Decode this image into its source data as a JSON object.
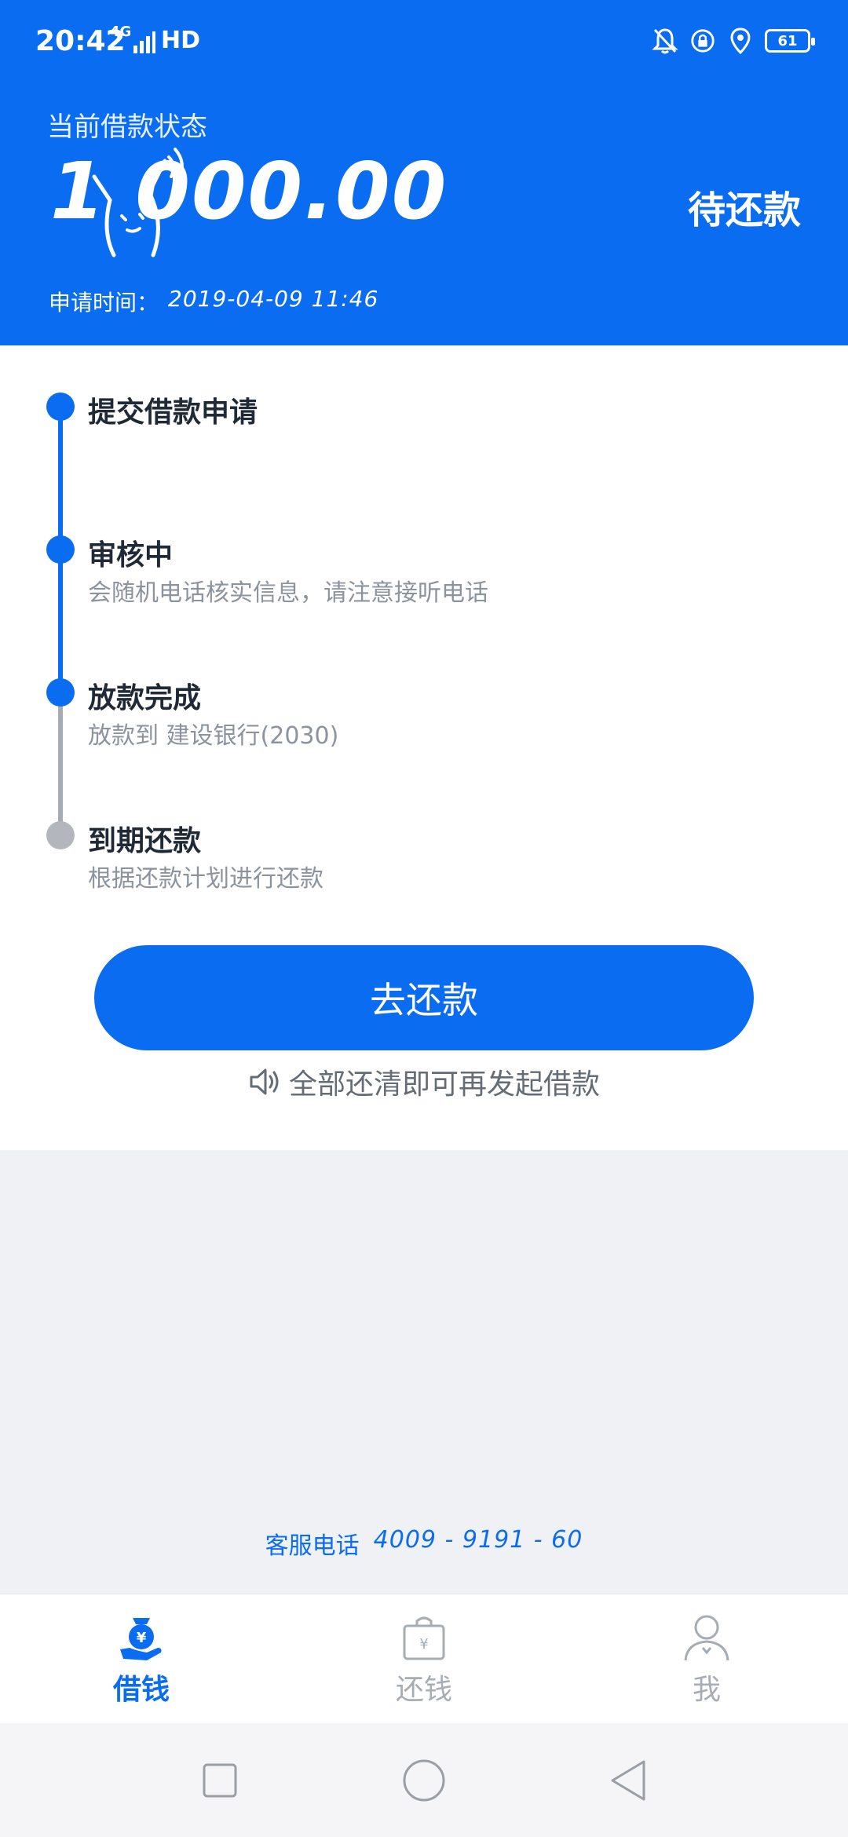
{
  "statusbar": {
    "time": "20:42",
    "network": "4G",
    "hd": "HD",
    "battery": "61"
  },
  "header": {
    "status_label": "当前借款状态",
    "amount": "1 000.00",
    "status_value": "待还款",
    "apply_time_label": "申请时间：",
    "apply_time_value": "2019-04-09 11:46"
  },
  "timeline": [
    {
      "title": "提交借款申请",
      "desc": "",
      "state": "done"
    },
    {
      "title": "审核中",
      "desc": "会随机电话核实信息，请注意接听电话",
      "state": "done"
    },
    {
      "title": "放款完成",
      "desc": "放款到 建设银行(2030)",
      "state": "done"
    },
    {
      "title": "到期还款",
      "desc": "根据还款计划进行还款",
      "state": "pending"
    }
  ],
  "cta": {
    "label": "去还款"
  },
  "notice": {
    "text": "全部还清即可再发起借款",
    "icon": "speaker-icon"
  },
  "service": {
    "label": "客服电话",
    "phone": "4009 - 9191 - 60"
  },
  "tabs": [
    {
      "label": "借钱",
      "icon": "money-hand-icon",
      "active": true
    },
    {
      "label": "还钱",
      "icon": "repay-bag-icon",
      "active": false
    },
    {
      "label": "我",
      "icon": "person-icon",
      "active": false
    }
  ],
  "colors": {
    "brand": "#0a6cf0",
    "done": "#0a6cf0",
    "pending": "#b3b7bd",
    "background": "#f0f1f5"
  }
}
